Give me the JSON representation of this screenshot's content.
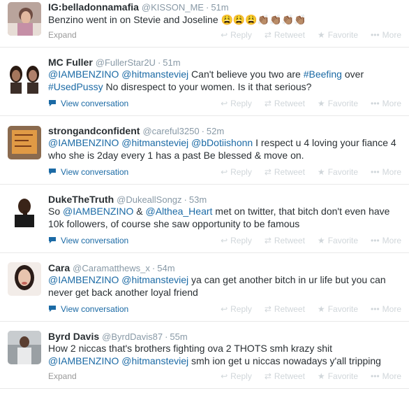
{
  "actions": {
    "reply": "Reply",
    "retweet": "Retweet",
    "favorite": "Favorite",
    "more": "More"
  },
  "tweets": [
    {
      "name": "IG:belladonnamafia",
      "handle": "@KISSON_ME",
      "dot": "·",
      "time": "51m",
      "lines": [
        [
          {
            "t": "text",
            "v": "Benzino went in on Stevie and Joseline "
          },
          {
            "t": "emoji",
            "v": "😩😩😩👏🏽👏🏽👏🏽👏🏽"
          }
        ]
      ],
      "footer_type": "expand",
      "footer_label": "Expand"
    },
    {
      "name": "MC Fuller",
      "handle": "@FullerStar2U",
      "dot": "·",
      "time": "51m",
      "lines": [
        [
          {
            "t": "mention",
            "v": "@IAMBENZINO"
          },
          {
            "t": "text",
            "v": " "
          },
          {
            "t": "mention",
            "v": "@hitmansteviej"
          },
          {
            "t": "text",
            "v": " Can't believe you two are "
          },
          {
            "t": "hashtag",
            "v": "#Beefing"
          },
          {
            "t": "text",
            "v": " over"
          }
        ],
        [
          {
            "t": "hashtag",
            "v": "#UsedPussy"
          },
          {
            "t": "text",
            "v": " No disrespect to your women. Is it that serious?"
          }
        ]
      ],
      "footer_type": "conversation",
      "footer_label": "View conversation"
    },
    {
      "name": "strongandconfident",
      "handle": "@careful3250",
      "dot": "·",
      "time": "52m",
      "lines": [
        [
          {
            "t": "mention",
            "v": "@IAMBENZINO"
          },
          {
            "t": "text",
            "v": " "
          },
          {
            "t": "mention",
            "v": "@hitmansteviej"
          },
          {
            "t": "text",
            "v": " "
          },
          {
            "t": "mention",
            "v": "@bDotiishonn"
          },
          {
            "t": "text",
            "v": " I respect u 4 loving your fiance 4"
          }
        ],
        [
          {
            "t": "text",
            "v": "who she is 2day every 1 has a  past Be blessed & move on."
          }
        ]
      ],
      "footer_type": "conversation",
      "footer_label": "View conversation"
    },
    {
      "name": "DukeTheTruth",
      "handle": "@DukeallSongz",
      "dot": "·",
      "time": "53m",
      "lines": [
        [
          {
            "t": "text",
            "v": "So "
          },
          {
            "t": "mention",
            "v": "@IAMBENZINO"
          },
          {
            "t": "text",
            "v": " & "
          },
          {
            "t": "mention",
            "v": "@Althea_Heart"
          },
          {
            "t": "text",
            "v": " met on twitter, that bitch don't even have"
          }
        ],
        [
          {
            "t": "text",
            "v": "10k followers, of course she saw opportunity to be famous"
          }
        ]
      ],
      "footer_type": "conversation",
      "footer_label": "View conversation"
    },
    {
      "name": "Cara",
      "handle": "@Caramatthews_x",
      "dot": "·",
      "time": "54m",
      "lines": [
        [
          {
            "t": "mention",
            "v": "@IAMBENZINO"
          },
          {
            "t": "text",
            "v": " "
          },
          {
            "t": "mention",
            "v": "@hitmansteviej"
          },
          {
            "t": "text",
            "v": " ya can get another bitch in ur life but you can"
          }
        ],
        [
          {
            "t": "text",
            "v": "never get back another loyal friend"
          }
        ]
      ],
      "footer_type": "conversation",
      "footer_label": "View conversation"
    },
    {
      "name": "Byrd Davis",
      "handle": "@ByrdDavis87",
      "dot": "·",
      "time": "55m",
      "lines": [
        [
          {
            "t": "text",
            "v": "How 2 niccas that's brothers fighting ova 2 THOTS smh krazy shit"
          }
        ],
        [
          {
            "t": "mention",
            "v": "@IAMBENZINO"
          },
          {
            "t": "text",
            "v": " "
          },
          {
            "t": "mention",
            "v": "@hitmansteviej"
          },
          {
            "t": "text",
            "v": " smh ion get u niccas nowadays y'all tripping"
          }
        ]
      ],
      "footer_type": "expand",
      "footer_label": "Expand"
    }
  ],
  "colors": {
    "link": "#1b6aa5",
    "muted": "#8899a6",
    "action_disabled": "#d0d6da"
  }
}
